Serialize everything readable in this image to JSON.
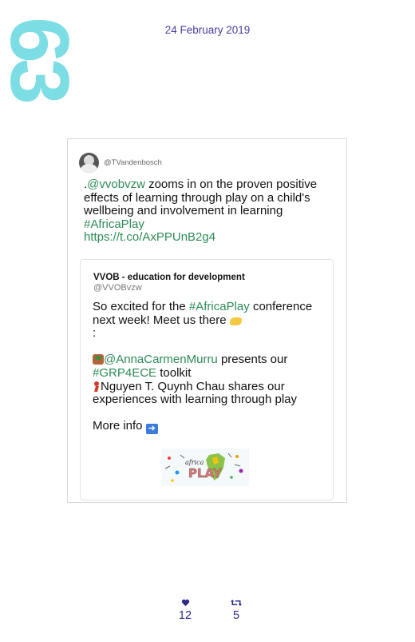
{
  "page": {
    "number": "63",
    "date": "24 February 2019"
  },
  "tweet": {
    "handle": "@TVandenbosch",
    "text_prefix": ".",
    "mention": "@vvobvzw",
    "text_body": " zooms in on the proven positive effects of learning through play on a child's wellbeing and involvement in learning ",
    "hashtag": "#AfricaPlay",
    "url": "https://t.co/AxPPUnB2g4",
    "quoted": {
      "name": "VVOB - education for development",
      "handle": "@VVOBvzw",
      "line1_prefix": "So excited for the ",
      "line1_hashtag": "#AfricaPlay",
      "line1_suffix": " conference next week! Meet us there",
      "line1_end": ":",
      "mention": "@AnnaCarmenMurru",
      "presents": " presents our ",
      "hashtag2": "#GRP4ECE",
      "toolkit": " toolkit",
      "line3": "Nguyen T. Quynh Chau shares our experiences with learning through play",
      "more_info": "More info",
      "image_logo_text": "africa PLAY"
    }
  },
  "stats": {
    "likes": "12",
    "retweets": "5"
  },
  "colors": {
    "page_number": "#7ddde4",
    "date": "#4a3ea0",
    "link": "#2e8b57",
    "stats": "#2b2a8c"
  }
}
